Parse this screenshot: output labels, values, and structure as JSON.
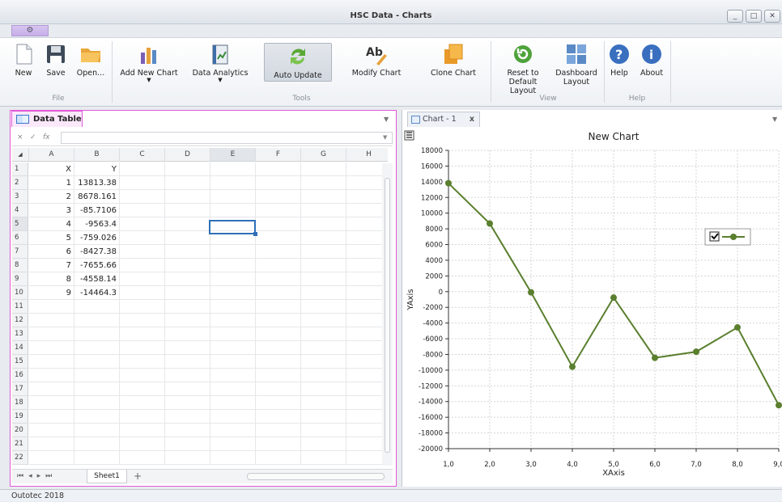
{
  "window": {
    "title": "HSC Data - Charts",
    "controls": [
      "_",
      "□",
      "✕"
    ]
  },
  "ribbon": {
    "buttons": [
      {
        "id": "new",
        "label": "New"
      },
      {
        "id": "save",
        "label": "Save"
      },
      {
        "id": "open",
        "label": "Open..."
      },
      {
        "id": "add_chart",
        "label": "Add New Chart"
      },
      {
        "id": "data_analytics",
        "label": "Data Analytics"
      },
      {
        "id": "auto_update",
        "label": "Auto Update"
      },
      {
        "id": "modify_chart",
        "label": "Modify Chart"
      },
      {
        "id": "clone_chart",
        "label": "Clone Chart"
      },
      {
        "id": "reset_layout",
        "label": "Reset to Default Layout"
      },
      {
        "id": "dashboard_layout",
        "label": "Dashboard Layout"
      },
      {
        "id": "help",
        "label": "Help"
      },
      {
        "id": "about",
        "label": "About"
      }
    ],
    "groups": {
      "file": "File",
      "tools": "Tools",
      "view": "View",
      "help": "Help"
    },
    "modify_icon_text": "Ab"
  },
  "data_table": {
    "tab_label": "Data Table",
    "formula_icons": [
      "×",
      "✓",
      "fx"
    ],
    "columns": [
      "A",
      "B",
      "C",
      "D",
      "E",
      "F",
      "G",
      "H"
    ],
    "row_numbers": [
      "1",
      "2",
      "3",
      "4",
      "5",
      "6",
      "7",
      "8",
      "9",
      "10",
      "11",
      "12",
      "13",
      "14",
      "15",
      "16",
      "17",
      "18",
      "19",
      "20",
      "21",
      "22"
    ],
    "rows": [
      [
        "X",
        "Y"
      ],
      [
        "1",
        "13813.38"
      ],
      [
        "2",
        "8678.161"
      ],
      [
        "3",
        "-85.7106"
      ],
      [
        "4",
        "-9563.4"
      ],
      [
        "5",
        "-759.026"
      ],
      [
        "6",
        "-8427.38"
      ],
      [
        "7",
        "-7655.66"
      ],
      [
        "8",
        "-4558.14"
      ],
      [
        "9",
        "-14464.3"
      ]
    ],
    "selected_cell": "E5",
    "sheet_tab": "Sheet1",
    "sheet_add": "+"
  },
  "chart_tab": {
    "label": "Chart - 1",
    "close": "x"
  },
  "chart_data": {
    "type": "line",
    "title": "New Chart",
    "xlabel": "XAxis",
    "ylabel": "YAxis",
    "x": [
      1,
      2,
      3,
      4,
      5,
      6,
      7,
      8,
      9
    ],
    "x_tick_labels": [
      "1,0",
      "2,0",
      "3,0",
      "4,0",
      "5,0",
      "6,0",
      "7,0",
      "8,0",
      "9,0"
    ],
    "series": [
      {
        "values": [
          13813.38,
          8678.161,
          -85.7106,
          -9563.4,
          -759.026,
          -8427.38,
          -7655.66,
          -4558.14,
          -14464.3
        ],
        "color": "#5a7f2e"
      }
    ],
    "ylim": [
      -20000,
      18000
    ],
    "xlim": [
      1,
      9
    ],
    "y_ticks": [
      18000,
      16000,
      14000,
      12000,
      10000,
      8000,
      6000,
      4000,
      2000,
      0,
      -2000,
      -4000,
      -6000,
      -8000,
      -10000,
      -12000,
      -14000,
      -16000,
      -18000,
      -20000
    ],
    "grid": true,
    "legend": "right, checkbox checked"
  },
  "status": {
    "text": "Outotec 2018"
  },
  "colors": {
    "accent_tab": "#e05ad8",
    "series": "#5a7f2e",
    "selection": "#2f6fb8"
  }
}
